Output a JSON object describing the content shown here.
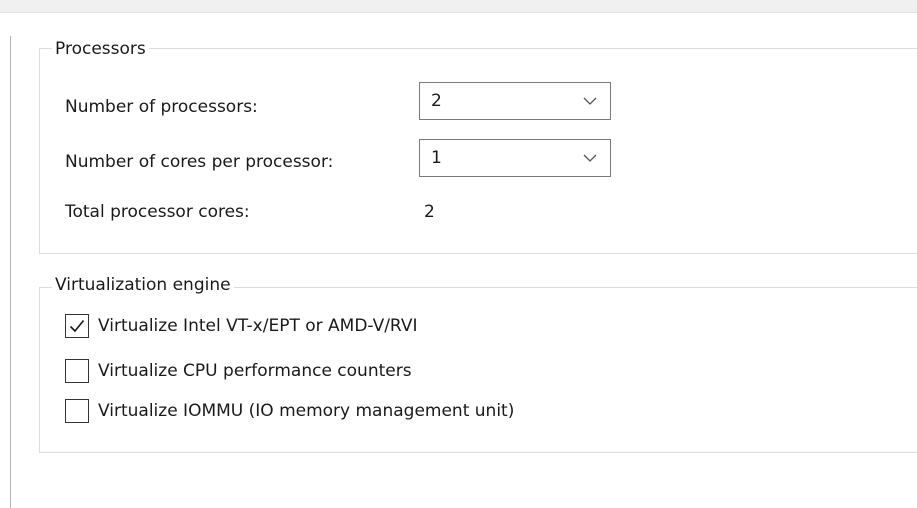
{
  "processors": {
    "title": "Processors",
    "num_processors": {
      "label": "Number of processors:",
      "value": "2"
    },
    "cores_per_processor": {
      "label": "Number of cores per processor:",
      "value": "1"
    },
    "total_cores": {
      "label": "Total processor cores:",
      "value": "2"
    }
  },
  "virtualization": {
    "title": "Virtualization engine",
    "options": [
      {
        "label": "Virtualize Intel VT-x/EPT or AMD-V/RVI",
        "checked": true
      },
      {
        "label": "Virtualize CPU performance counters",
        "checked": false
      },
      {
        "label": "Virtualize IOMMU (IO memory management unit)",
        "checked": false
      }
    ]
  },
  "icons": {
    "dropdown": "chevron-down-icon",
    "check": "checkmark-icon"
  },
  "colors": {
    "group_border": "#dcdcdc",
    "control_border": "#7a7a7a",
    "checkbox_border": "#333333",
    "text": "#1a1a1a"
  }
}
